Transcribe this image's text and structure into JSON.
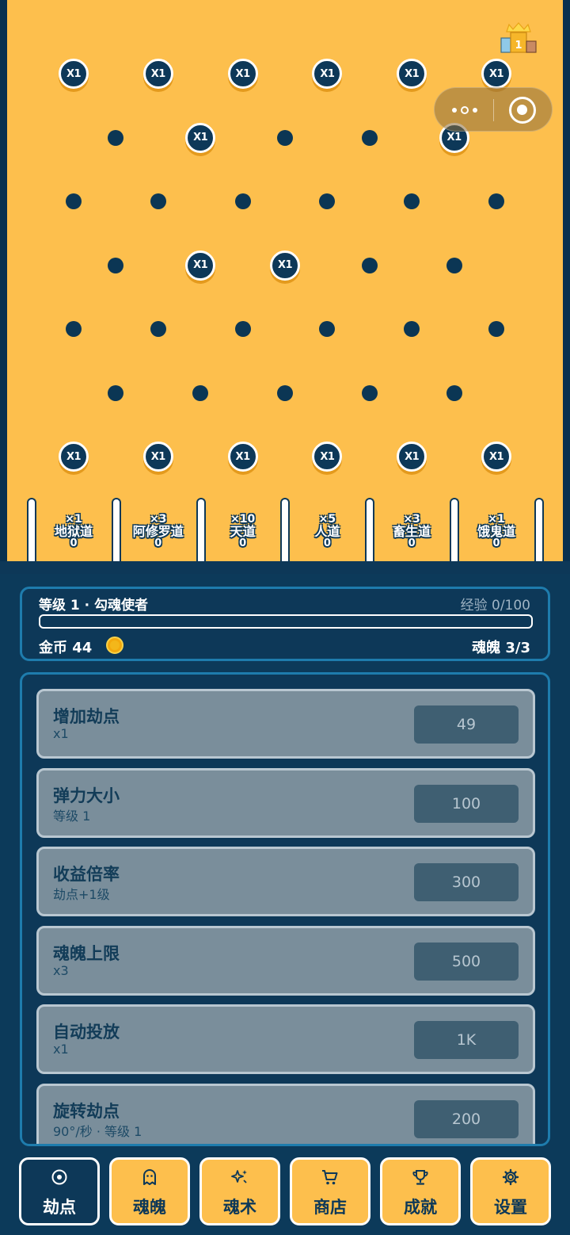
{
  "board": {
    "peg_rows": [
      {
        "type": "multiplier",
        "cols": [
          0,
          2,
          4,
          6,
          8,
          10
        ],
        "label": "X1"
      },
      {
        "type": "mixed",
        "cols": [
          1,
          3,
          5,
          7,
          9
        ],
        "multiplier_cols": [
          3,
          9
        ],
        "label": "X1"
      },
      {
        "type": "plain",
        "cols": [
          0,
          2,
          4,
          6,
          8,
          10
        ]
      },
      {
        "type": "mixed",
        "cols": [
          1,
          3,
          5,
          7,
          9
        ],
        "multiplier_cols": [
          3,
          5
        ],
        "label": "X1"
      },
      {
        "type": "plain",
        "cols": [
          0,
          2,
          4,
          6,
          8,
          10
        ]
      },
      {
        "type": "plain",
        "cols": [
          1,
          3,
          5,
          7,
          9
        ]
      },
      {
        "type": "multiplier",
        "cols": [
          0,
          2,
          4,
          6,
          8,
          10
        ],
        "label": "X1"
      }
    ],
    "bins": [
      {
        "multiplier": "×1",
        "name": "地狱道",
        "count": "0"
      },
      {
        "multiplier": "×3",
        "name": "阿修罗道",
        "count": "0"
      },
      {
        "multiplier": "×10",
        "name": "天道",
        "count": "0"
      },
      {
        "multiplier": "×5",
        "name": "人道",
        "count": "0"
      },
      {
        "multiplier": "×3",
        "name": "畜生道",
        "count": "0"
      },
      {
        "multiplier": "×1",
        "name": "饿鬼道",
        "count": "0"
      }
    ],
    "rank_badge": "1"
  },
  "stats": {
    "level": "等级 1 · 勾魂使者",
    "exp": "经验 0/100",
    "exp_progress": 0,
    "gold": "金币 44",
    "souls": "魂魄 3/3"
  },
  "upgrades": [
    {
      "title": "增加劫点",
      "sub": "x1",
      "price": "49"
    },
    {
      "title": "弹力大小",
      "sub": "等级 1",
      "price": "100"
    },
    {
      "title": "收益倍率",
      "sub": "劫点+1级",
      "price": "300"
    },
    {
      "title": "魂魄上限",
      "sub": "x3",
      "price": "500"
    },
    {
      "title": "自动投放",
      "sub": "x1",
      "price": "1K"
    },
    {
      "title": "旋转劫点",
      "sub": "90°/秒 · 等级 1",
      "price": "200"
    }
  ],
  "tabs": [
    {
      "label": "劫点",
      "icon": "target-icon",
      "active": true
    },
    {
      "label": "魂魄",
      "icon": "ghost-icon",
      "active": false
    },
    {
      "label": "魂术",
      "icon": "sparkle-icon",
      "active": false
    },
    {
      "label": "商店",
      "icon": "cart-icon",
      "active": false
    },
    {
      "label": "成就",
      "icon": "trophy-icon",
      "active": false
    },
    {
      "label": "设置",
      "icon": "gear-icon",
      "active": false
    }
  ],
  "colors": {
    "board": "#fdbf4d",
    "navy": "#0d3858",
    "panel_border": "#1e7cad",
    "card": "#7a8e9b"
  }
}
